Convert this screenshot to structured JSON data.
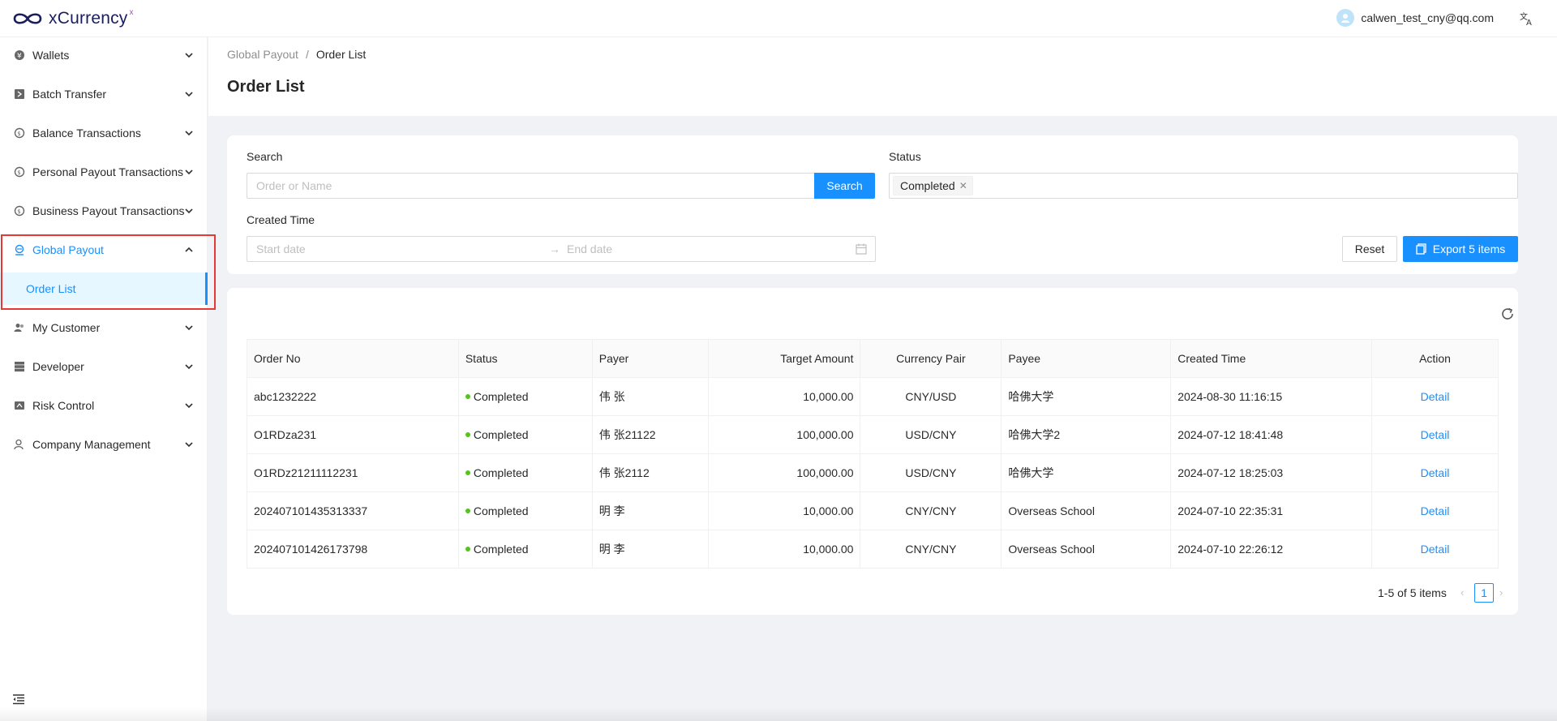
{
  "header": {
    "logo_text": "xCurrency",
    "logo_mark": "x",
    "user_email": "calwen_test_cny@qq.com",
    "lang_icon": "translate-icon"
  },
  "sidebar": {
    "items": [
      {
        "label": "Wallets",
        "icon": "wallet-icon"
      },
      {
        "label": "Batch Transfer",
        "icon": "transfer-icon"
      },
      {
        "label": "Balance Transactions",
        "icon": "exchange-icon"
      },
      {
        "label": "Personal Payout Transactions",
        "icon": "exchange-icon"
      },
      {
        "label": "Business Payout Transactions",
        "icon": "exchange-icon"
      },
      {
        "label": "Global Payout",
        "icon": "bank-icon"
      },
      {
        "label": "My Customer",
        "icon": "users-icon"
      },
      {
        "label": "Developer",
        "icon": "database-icon"
      },
      {
        "label": "Risk Control",
        "icon": "shield-icon"
      },
      {
        "label": "Company Management",
        "icon": "user-settings-icon"
      }
    ],
    "sub_item": "Order List"
  },
  "breadcrumb": {
    "parent": "Global Payout",
    "separator": "/",
    "current": "Order List"
  },
  "page": {
    "title": "Order List"
  },
  "filters": {
    "search_label": "Search",
    "search_placeholder": "Order or Name",
    "search_button": "Search",
    "status_label": "Status",
    "status_tag": "Completed",
    "created_label": "Created Time",
    "start_placeholder": "Start date",
    "end_placeholder": "End date",
    "reset_button": "Reset",
    "export_button": "Export 5 items"
  },
  "table": {
    "columns": [
      "Order No",
      "Status",
      "Payer",
      "Target Amount",
      "Currency Pair",
      "Payee",
      "Created Time",
      "Action"
    ],
    "rows": [
      {
        "order_no": "abc1232222",
        "status": "Completed",
        "payer": "伟 张",
        "amount": "10,000.00",
        "pair": "CNY/USD",
        "payee": "哈佛大学",
        "created": "2024-08-30 11:16:15",
        "action": "Detail"
      },
      {
        "order_no": "O1RDza231",
        "status": "Completed",
        "payer": "伟 张21122",
        "amount": "100,000.00",
        "pair": "USD/CNY",
        "payee": "哈佛大学2",
        "created": "2024-07-12 18:41:48",
        "action": "Detail"
      },
      {
        "order_no": "O1RDz21211112231",
        "status": "Completed",
        "payer": "伟 张2112",
        "amount": "100,000.00",
        "pair": "USD/CNY",
        "payee": "哈佛大学",
        "created": "2024-07-12 18:25:03",
        "action": "Detail"
      },
      {
        "order_no": "202407101435313337",
        "status": "Completed",
        "payer": "明 李",
        "amount": "10,000.00",
        "pair": "CNY/CNY",
        "payee": "Overseas School",
        "created": "2024-07-10 22:35:31",
        "action": "Detail"
      },
      {
        "order_no": "202407101426173798",
        "status": "Completed",
        "payer": "明 李",
        "amount": "10,000.00",
        "pair": "CNY/CNY",
        "payee": "Overseas School",
        "created": "2024-07-10 22:26:12",
        "action": "Detail"
      }
    ]
  },
  "pagination": {
    "total": "1-5 of 5 items",
    "current": "1"
  },
  "colors": {
    "primary": "#1890ff",
    "success": "#52c41a",
    "highlight": "#e53935"
  }
}
